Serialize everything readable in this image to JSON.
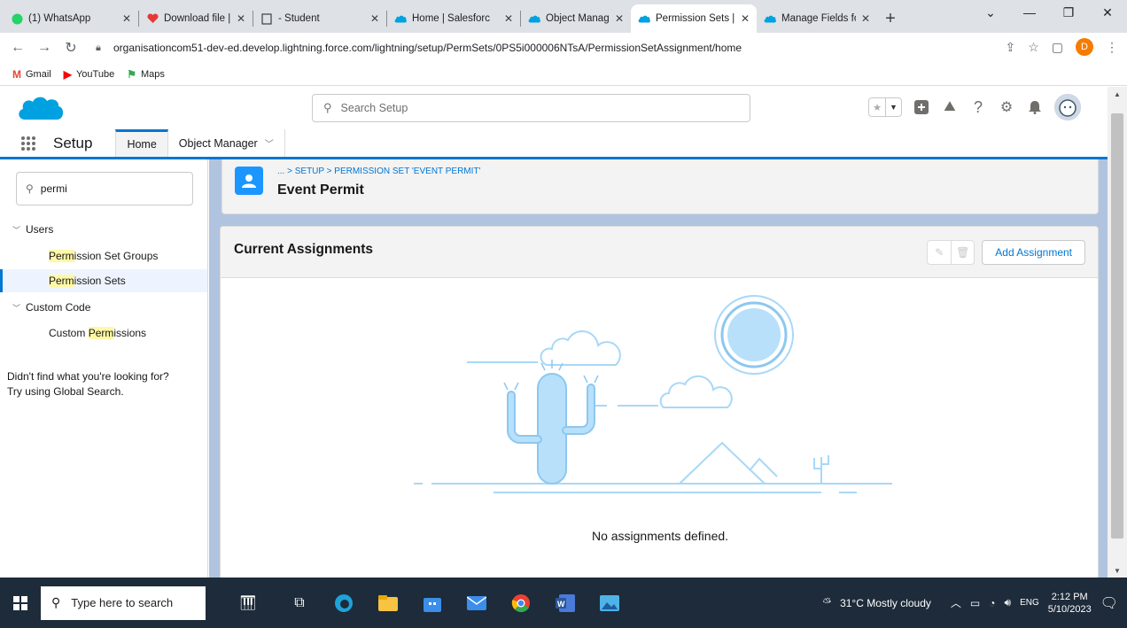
{
  "browser": {
    "tabs": [
      {
        "title": "(1) WhatsApp",
        "icon": "whatsapp-icon",
        "active": false
      },
      {
        "title": "Download file | il",
        "icon": "heart-icon",
        "active": false
      },
      {
        "title": "- Student",
        "icon": "document-icon",
        "active": false
      },
      {
        "title": "Home | Salesforc",
        "icon": "salesforce-cloud-icon",
        "active": false
      },
      {
        "title": "Object Manager |",
        "icon": "salesforce-cloud-icon",
        "active": false
      },
      {
        "title": "Permission Sets |",
        "icon": "salesforce-cloud-icon",
        "active": true
      },
      {
        "title": "Manage Fields fo",
        "icon": "salesforce-cloud-icon",
        "active": false
      }
    ],
    "url": "organisationcom51-dev-ed.develop.lightning.force.com/lightning/setup/PermSets/0PS5i000006NTsA/PermissionSetAssignment/home",
    "profile_initial": "D",
    "bookmarks": [
      {
        "label": "Gmail",
        "icon": "gmail-icon",
        "color": "#ea4335"
      },
      {
        "label": "YouTube",
        "icon": "youtube-icon",
        "color": "#ff0000"
      },
      {
        "label": "Maps",
        "icon": "maps-icon",
        "color": "#34a853"
      }
    ]
  },
  "sf": {
    "search_placeholder": "Search Setup",
    "app_name": "Setup",
    "nav_tabs": [
      {
        "label": "Home"
      },
      {
        "label": "Object Manager"
      }
    ]
  },
  "sidebar": {
    "quickfind_value": "permi",
    "categories": [
      {
        "label": "Users",
        "items": [
          {
            "match": "Perm",
            "rest": "ission Set Groups",
            "selected": false
          },
          {
            "match": "Perm",
            "rest": "ission Sets",
            "selected": true
          }
        ]
      },
      {
        "label": "Custom Code",
        "items": [
          {
            "prefix": "Custom ",
            "match": "Perm",
            "rest": "issions",
            "selected": false
          }
        ]
      }
    ],
    "not_found_line1": "Didn't find what you're looking for?",
    "not_found_line2": "Try using Global Search."
  },
  "page": {
    "breadcrumb": "... > SETUP > PERMISSION SET 'EVENT PERMIT'",
    "title": "Event Permit"
  },
  "card": {
    "title": "Current Assignments",
    "add_button": "Add Assignment",
    "empty_message": "No assignments defined."
  },
  "taskbar": {
    "search_placeholder": "Type here to search",
    "weather": "31°C  Mostly cloudy",
    "lang": "ENG",
    "time": "2:12 PM",
    "date": "5/10/2023"
  },
  "colors": {
    "brand_blue": "#0176d3",
    "sf_cloud": "#00a1e0",
    "content_bg": "#b0c4df",
    "illustration_blue": "#a8d8f8"
  }
}
